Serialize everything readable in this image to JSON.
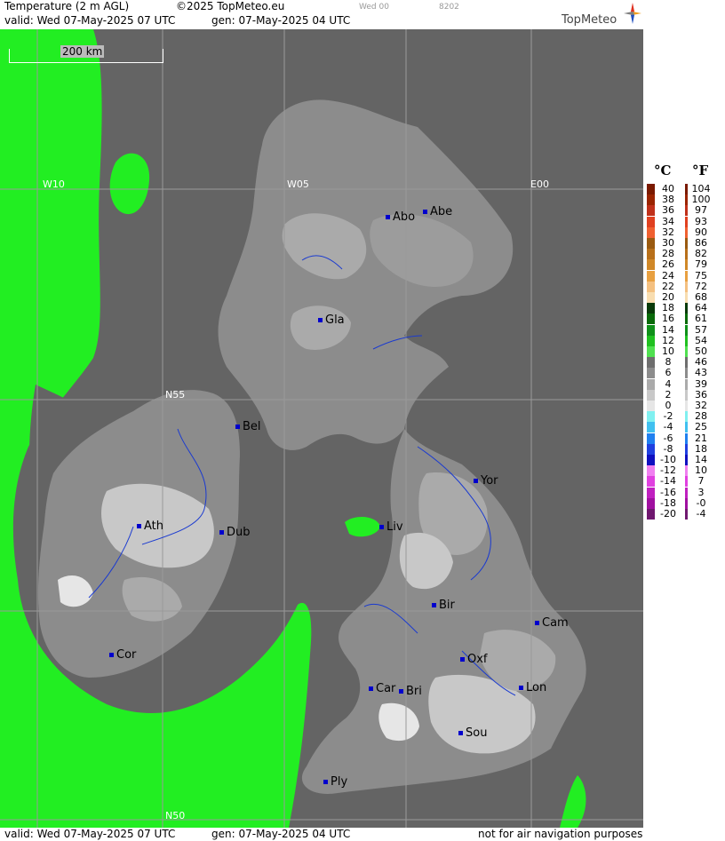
{
  "header": {
    "title": "Temperature (2 m AGL)",
    "copyright": "©2025 TopMeteo.eu",
    "run_label": "Wed 00",
    "code": "8202",
    "valid": "valid:  Wed  07-May-2025  07 UTC",
    "gen": "gen: 07-May-2025 04 UTC",
    "logo": "TopMeteo"
  },
  "footer": {
    "valid": "valid:  Wed  07-May-2025  07 UTC",
    "gen": "gen: 07-May-2025 04 UTC",
    "disclaimer": "not for air navigation purposes"
  },
  "map": {
    "scale_label": "200 km",
    "grid_labels": [
      "W10",
      "W05",
      "E00",
      "N55",
      "N50"
    ],
    "cities": [
      "Abo",
      "Abe",
      "Gla",
      "Bel",
      "Yor",
      "Ath",
      "Dub",
      "Liv",
      "Bir",
      "Cam",
      "Cor",
      "Oxf",
      "Car",
      "Bri",
      "Lon",
      "Sou",
      "Ply"
    ]
  },
  "legend": {
    "unit_c": "°C",
    "unit_f": "°F",
    "celsius_ticks": [
      "40",
      "38",
      "36",
      "34",
      "32",
      "30",
      "28",
      "26",
      "24",
      "22",
      "20",
      "18",
      "16",
      "14",
      "12",
      "10",
      "8",
      "6",
      "4",
      "2",
      "0",
      "-2",
      "-4",
      "-6",
      "-8",
      "-10",
      "-12",
      "-14",
      "-16",
      "-18",
      "-20"
    ],
    "fahrenheit_ticks": [
      "104",
      "100",
      "97",
      "93",
      "90",
      "86",
      "82",
      "79",
      "75",
      "72",
      "68",
      "64",
      "61",
      "57",
      "54",
      "50",
      "46",
      "43",
      "39",
      "36",
      "32",
      "28",
      "25",
      "21",
      "18",
      "14",
      "10",
      "7",
      "3",
      "-0",
      "-4"
    ],
    "colors": [
      "#7a1a00",
      "#9a2400",
      "#c0301a",
      "#e04020",
      "#f06030",
      "#9a5a10",
      "#b8701a",
      "#d08828",
      "#e8a040",
      "#f4c080",
      "#f8ddb0",
      "#0a3a0a",
      "#0a6a0a",
      "#10901a",
      "#20c020",
      "#50e050",
      "#6e6e6e",
      "#8c8c8c",
      "#aaaaaa",
      "#c8c8c8",
      "#e6e6e6",
      "#80f0f0",
      "#40c0f0",
      "#2080f0",
      "#2040e0",
      "#1010c0",
      "#f080f0",
      "#e040e0",
      "#c020c0",
      "#a010a0",
      "#701870"
    ]
  }
}
